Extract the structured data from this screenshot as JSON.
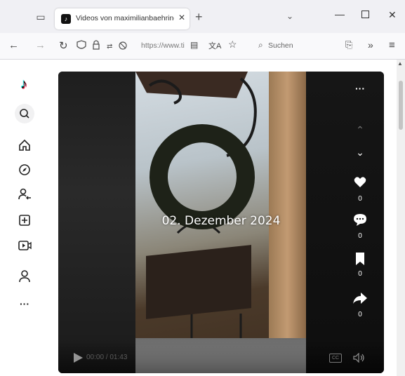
{
  "browser": {
    "tab_title": "Videos von maximilianbaehring",
    "tab_favicon": "tiktok-icon",
    "tab_close": "✕",
    "newtab": "+",
    "tabs_dropdown": "⌄",
    "url": "https://www.tik",
    "search_placeholder": "Suchen"
  },
  "sidebar": {
    "items": [
      {
        "name": "tiktok-logo",
        "glyph": "♪"
      },
      {
        "name": "search",
        "glyph": "⌕"
      },
      {
        "name": "home",
        "glyph": "⌂"
      },
      {
        "name": "explore",
        "glyph": "◎"
      },
      {
        "name": "following",
        "glyph": "♙"
      },
      {
        "name": "upload",
        "glyph": "⊞"
      },
      {
        "name": "live",
        "glyph": "▷"
      },
      {
        "name": "profile",
        "glyph": "♙"
      },
      {
        "name": "more",
        "glyph": "···"
      }
    ]
  },
  "video": {
    "overlay_text": "02. Dezember 2024",
    "more_glyph": "···",
    "prev_glyph": "⌃",
    "next_glyph": "⌄",
    "like_count": "0",
    "comment_count": "0",
    "bookmark_count": "0",
    "share_count": "0",
    "time": "00:00 / 01:43",
    "cc_label": "CC"
  },
  "colors": {
    "accent": "#fe2c55",
    "tab_bg": "#f0f0f4",
    "toolbar_bg": "#f9f9fb",
    "video_bg": "#1a1a1a"
  }
}
